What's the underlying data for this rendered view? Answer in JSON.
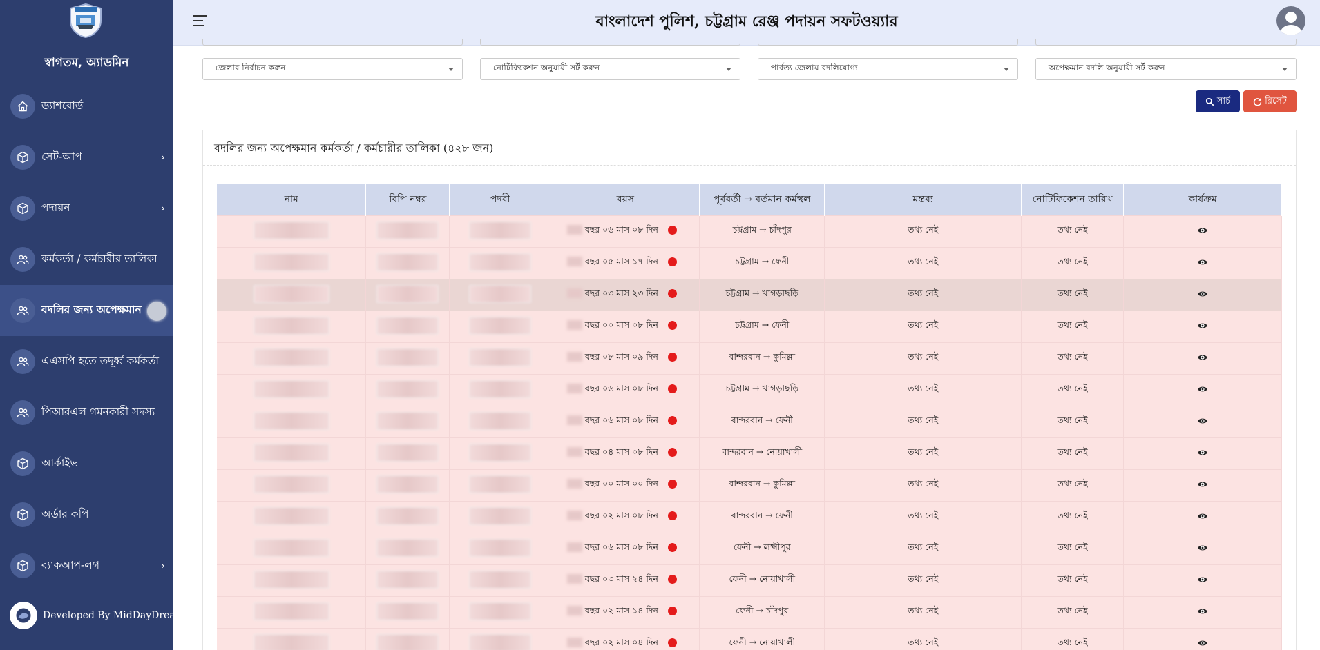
{
  "sidebar": {
    "welcome": "স্বাগতম, অ্যাডমিন",
    "items": [
      {
        "label": "ড্যাশবোর্ড",
        "icon": "home-icon",
        "chevron": ""
      },
      {
        "label": "সেট-আপ",
        "icon": "cube-icon",
        "chevron": "›"
      },
      {
        "label": "পদায়ন",
        "icon": "cube-icon",
        "chevron": "›"
      },
      {
        "label": "কর্মকর্তা / কর্মচারীর তালিকা",
        "icon": "users-icon",
        "chevron": ""
      },
      {
        "label": "বদলির জন্য অপেক্ষমান",
        "icon": "users-icon",
        "chevron": "",
        "active": true
      },
      {
        "label": "এএসপি হতে তদূর্ধ্ব কর্মকর্তা",
        "icon": "users-icon",
        "chevron": ""
      },
      {
        "label": "পিআরএল গমনকারী সদস্য",
        "icon": "users-icon",
        "chevron": ""
      },
      {
        "label": "আর্কাইভ",
        "icon": "cube-icon",
        "chevron": ""
      },
      {
        "label": "অর্ডার কপি",
        "icon": "cube-icon",
        "chevron": ""
      },
      {
        "label": "ব্যাকআপ-লগ",
        "icon": "cube-icon",
        "chevron": "›"
      }
    ],
    "developer": "Developed By MidDayDreams"
  },
  "header": {
    "title": "বাংলাদেশ পুলিশ, চট্টগ্রাম রেঞ্জ পদায়ন সফটওয়্যার"
  },
  "filters": [
    "- জেলার নির্বাচন করুন -",
    "- নোটিফিকেশন অনুযায়ী সর্ট করুন -",
    "- পার্বত্য জেলায় বদলিযোগ্য -",
    "- অপেক্ষমান বদলি অনুযায়ী সর্ট করুন -"
  ],
  "buttons": {
    "search": "সার্চ",
    "reset": "রিসেট"
  },
  "card": {
    "title": "বদলির জন্য অপেক্ষমান কর্মকর্তা / কর্মচারীর তালিকা (৪২৮ জন)"
  },
  "table": {
    "columns": [
      "নাম",
      "বিপি নম্বর",
      "পদবী",
      "বয়স",
      "পূর্ববর্তী → বর্তমান কর্মস্থল",
      "মন্তব্য",
      "নোটিফিকেশন তারিখ",
      "কার্যক্রম"
    ],
    "rows": [
      {
        "age": "বছর ০৬ মাস ০৮ দিন",
        "route": "চট্টগ্রাম → চাঁদপুর",
        "comment": "তথ্য নেই",
        "notif": "তথ্য নেই"
      },
      {
        "age": "বছর ০৫ মাস ১৭ দিন",
        "route": "চট্টগ্রাম → ফেনী",
        "comment": "তথ্য নেই",
        "notif": "তথ্য নেই"
      },
      {
        "age": "বছর ০৩ মাস ২৩ দিন",
        "route": "চট্টগ্রাম → খাগড়াছড়ি",
        "comment": "তথ্য নেই",
        "notif": "তথ্য নেই",
        "highlight": true
      },
      {
        "age": "বছর ০০ মাস ০৮ দিন",
        "route": "চট্টগ্রাম → ফেনী",
        "comment": "তথ্য নেই",
        "notif": "তথ্য নেই"
      },
      {
        "age": "বছর ০৮ মাস ০৯ দিন",
        "route": "বান্দরবান → কুমিল্লা",
        "comment": "তথ্য নেই",
        "notif": "তথ্য নেই"
      },
      {
        "age": "বছর ০৬ মাস ০৮ দিন",
        "route": "চট্টগ্রাম → খাগড়াছড়ি",
        "comment": "তথ্য নেই",
        "notif": "তথ্য নেই"
      },
      {
        "age": "বছর ০৬ মাস ০৮ দিন",
        "route": "বান্দরবান → ফেনী",
        "comment": "তথ্য নেই",
        "notif": "তথ্য নেই"
      },
      {
        "age": "বছর ০৪ মাস ০৮ দিন",
        "route": "বান্দরবান → নোয়াখালী",
        "comment": "তথ্য নেই",
        "notif": "তথ্য নেই"
      },
      {
        "age": "বছর ০০ মাস ০০ দিন",
        "route": "বান্দরবান → কুমিল্লা",
        "comment": "তথ্য নেই",
        "notif": "তথ্য নেই"
      },
      {
        "age": "বছর ০২ মাস ০৮ দিন",
        "route": "বান্দরবান → ফেনী",
        "comment": "তথ্য নেই",
        "notif": "তথ্য নেই"
      },
      {
        "age": "বছর ০৬ মাস ০৮ দিন",
        "route": "ফেনী → লক্ষ্মীপুর",
        "comment": "তথ্য নেই",
        "notif": "তথ্য নেই"
      },
      {
        "age": "বছর ০৩ মাস ২৪ দিন",
        "route": "ফেনী → নোয়াখালী",
        "comment": "তথ্য নেই",
        "notif": "তথ্য নেই"
      },
      {
        "age": "বছর ০২ মাস ১৪ দিন",
        "route": "ফেনী → চাঁদপুর",
        "comment": "তথ্য নেই",
        "notif": "তথ্য নেই"
      },
      {
        "age": "বছর ০২ মাস ০৪ দিন",
        "route": "ফেনী → নোয়াখালী",
        "comment": "তথ্য নেই",
        "notif": "তথ্য নেই"
      }
    ]
  },
  "colors": {
    "sidebar_bg": "#2d3e6e",
    "header_bg": "#e6ebfa",
    "row_bg": "#fce3e2",
    "status_dot": "#e41b1b",
    "search_button": "#1a2a80",
    "reset_button": "#e0553f"
  }
}
